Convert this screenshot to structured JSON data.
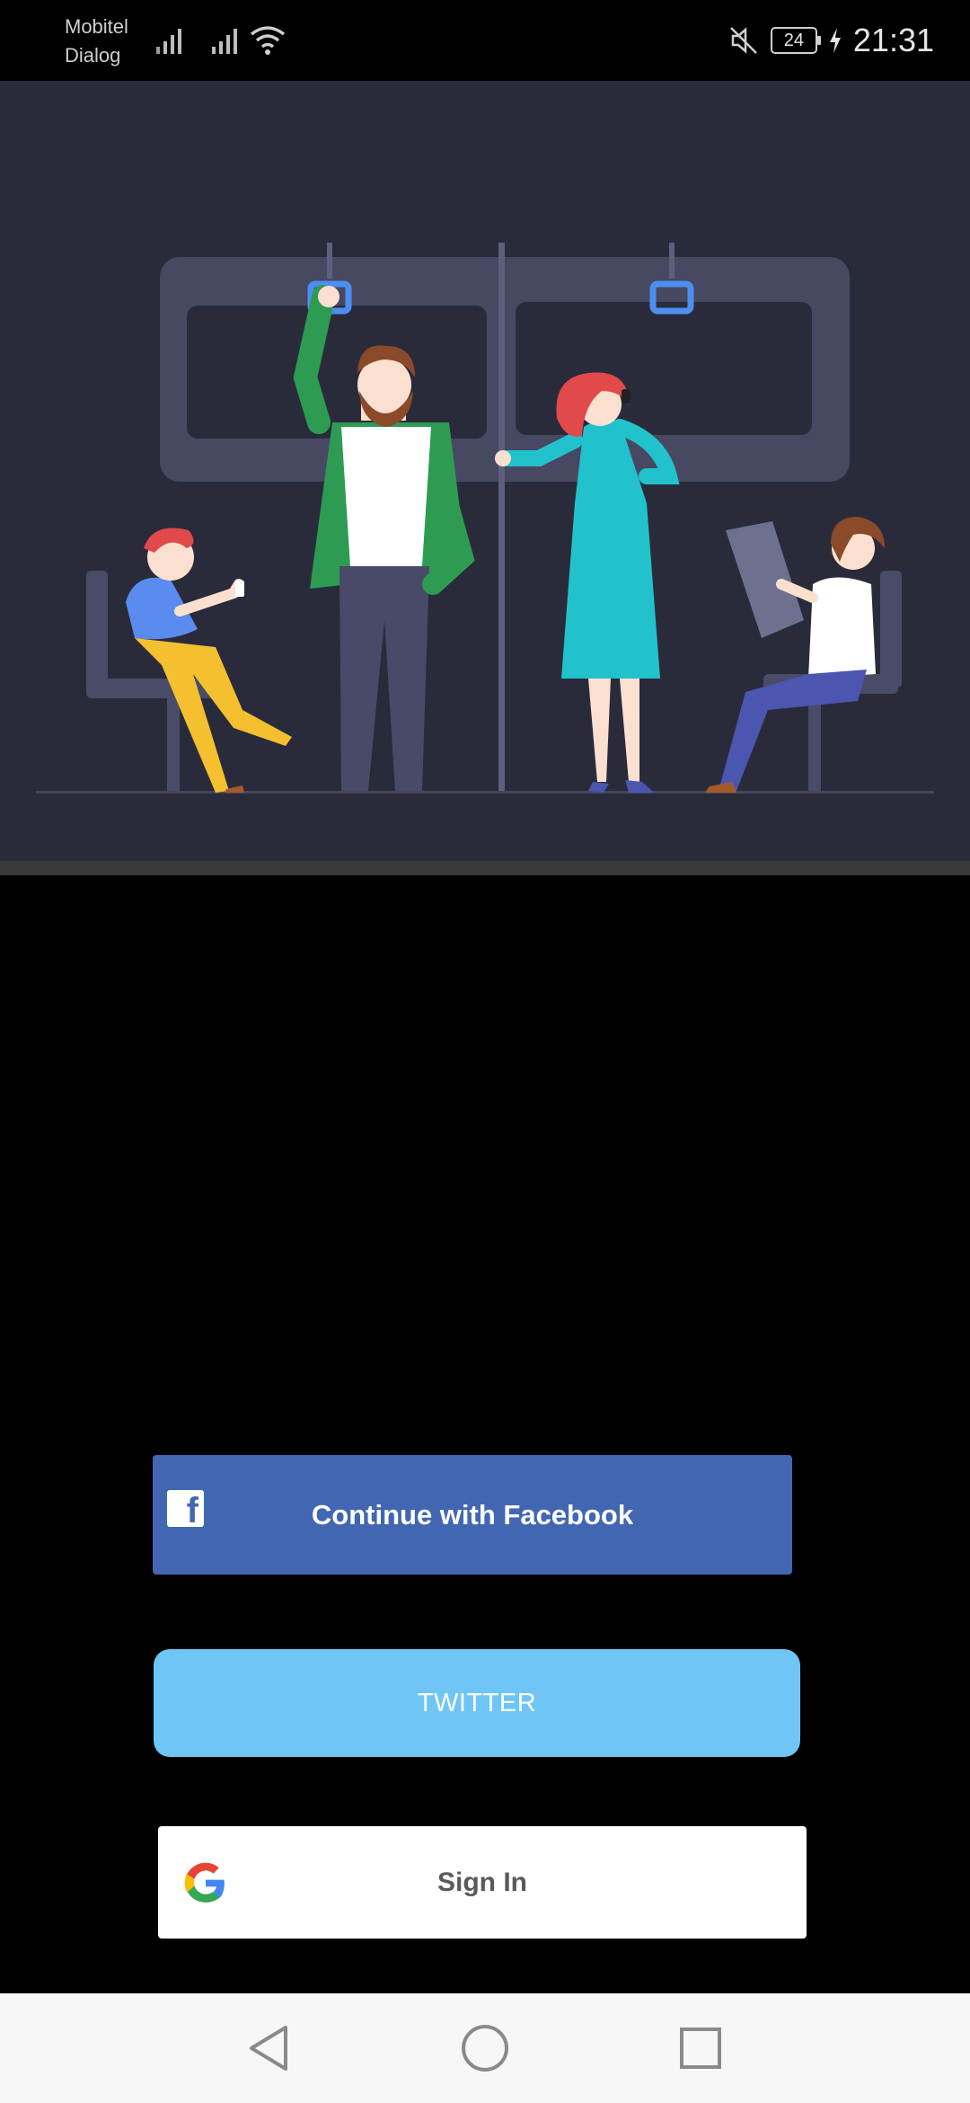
{
  "status_bar": {
    "carrier_line1": "Mobitel",
    "carrier_line2": "Dialog",
    "battery": "24",
    "time": "21:31"
  },
  "buttons": {
    "facebook_label": "Continue with Facebook",
    "twitter_label": "TWITTER",
    "google_label": "Sign In"
  },
  "colors": {
    "facebook": "#4267b2",
    "twitter": "#6fc6f4",
    "google_bg": "#ffffff",
    "illustration_bg": "#2a2b3a"
  },
  "icons": {
    "facebook": "facebook-logo-icon",
    "google": "google-logo-icon",
    "nav_back": "back-triangle-icon",
    "nav_home": "home-circle-icon",
    "nav_recents": "recents-square-icon"
  }
}
